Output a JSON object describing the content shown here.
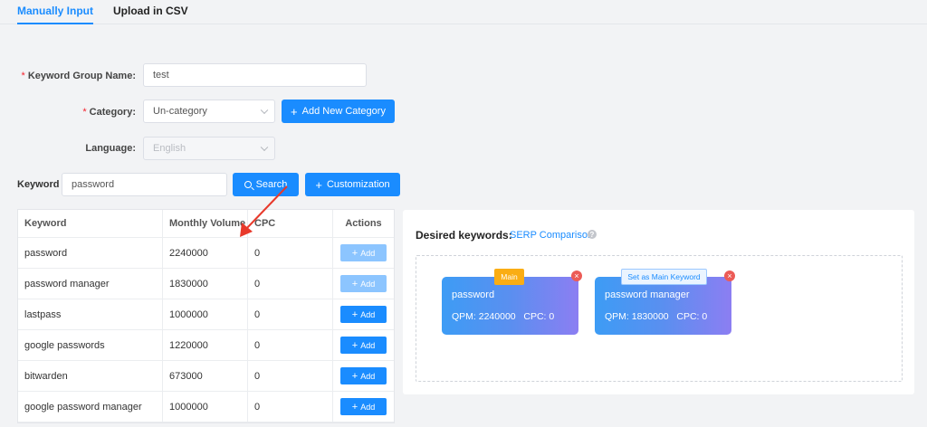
{
  "tabs": [
    {
      "label": "Manually Input",
      "active": true
    },
    {
      "label": "Upload in CSV",
      "active": false
    }
  ],
  "form": {
    "group_name": {
      "label": "Keyword Group Name:",
      "required": true,
      "value": "test"
    },
    "category": {
      "label": "Category:",
      "required": true,
      "value": "Un-category",
      "add_button": "Add New Category"
    },
    "language": {
      "label": "Language:",
      "required": false,
      "value": "English",
      "disabled": true
    }
  },
  "search": {
    "label": "Keyword",
    "value": "password",
    "search_button": "Search",
    "custom_button": "Customization"
  },
  "table": {
    "headers": [
      "Keyword",
      "Monthly Volume",
      "CPC",
      "Actions"
    ],
    "action_label": "Add",
    "rows": [
      {
        "keyword": "password",
        "volume": "2240000",
        "cpc": "0",
        "added": true
      },
      {
        "keyword": "password manager",
        "volume": "1830000",
        "cpc": "0",
        "added": true
      },
      {
        "keyword": "lastpass",
        "volume": "1000000",
        "cpc": "0",
        "added": false
      },
      {
        "keyword": "google passwords",
        "volume": "1220000",
        "cpc": "0",
        "added": false
      },
      {
        "keyword": "bitwarden",
        "volume": "673000",
        "cpc": "0",
        "added": false
      },
      {
        "keyword": "google password manager",
        "volume": "1000000",
        "cpc": "0",
        "added": false
      }
    ]
  },
  "desired": {
    "title": "Desired keywords:",
    "link": "SERP Comparison",
    "help_icon": "question-circle-icon",
    "cards": [
      {
        "name": "password",
        "stats": "QPM: 2240000   CPC: 0",
        "badge": "Main",
        "main": true
      },
      {
        "name": "password manager",
        "stats": "QPM: 1830000   CPC: 0",
        "badge": "Set as Main Keyword",
        "main": false
      }
    ]
  },
  "colors": {
    "accent": "#1a8cff",
    "badge_main": "#faad14",
    "close": "#ec5b56",
    "arrow": "#e8392b"
  }
}
